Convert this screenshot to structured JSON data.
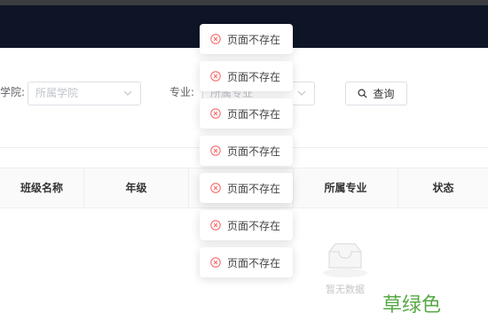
{
  "filters": {
    "college_label": "学院:",
    "college_placeholder": "所属学院",
    "major_label": "专业:",
    "major_placeholder": "所属专业",
    "query_button": "查询"
  },
  "table": {
    "columns": [
      "班级名称",
      "年级",
      "",
      "所属专业",
      "状态"
    ],
    "empty_text": "暂无数据"
  },
  "toasts": [
    "页面不存在",
    "页面不存在",
    "页面不存在",
    "页面不存在",
    "页面不存在",
    "页面不存在",
    "页面不存在"
  ],
  "watermark": "草绿色",
  "colors": {
    "header_bg": "#0d1526",
    "error_icon": "#f56c6c",
    "watermark": "#57a846"
  }
}
